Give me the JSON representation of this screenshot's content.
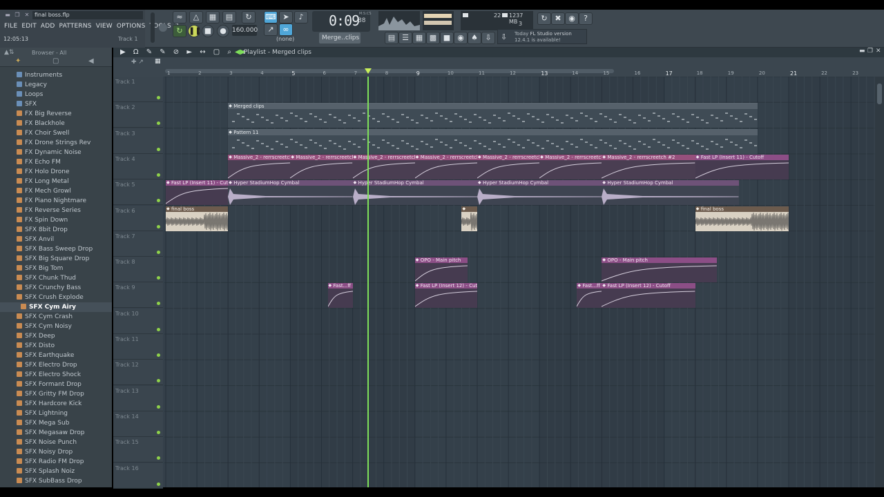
{
  "titlebar": {
    "filename": "final boss.flp"
  },
  "menu": [
    "FILE",
    "EDIT",
    "ADD",
    "PATTERNS",
    "VIEW",
    "OPTIONS",
    "TOOLS",
    "?"
  ],
  "status": {
    "time": "12:05:13",
    "hint": "Track 1"
  },
  "transport": {
    "tempo": "160.000",
    "time_main": "0:09",
    "time_sub": "88",
    "time_unit": "M:S:CS",
    "pattern": "Merge..clips",
    "none": "(none)"
  },
  "monitor": {
    "cpu": "22",
    "mem": "1237 MB",
    "poly": "3"
  },
  "news": {
    "title": "Today",
    "line1": "FL Studio version",
    "line2": "12.4.1 is available!"
  },
  "browser": {
    "title": "Browser - All",
    "items": [
      {
        "label": "Instruments",
        "kind": "folder"
      },
      {
        "label": "Legacy",
        "kind": "folder"
      },
      {
        "label": "Loops",
        "kind": "folder"
      },
      {
        "label": "SFX",
        "kind": "folder"
      },
      {
        "label": "FX Big Reverse",
        "kind": "file"
      },
      {
        "label": "FX Blackhole",
        "kind": "file"
      },
      {
        "label": "FX Choir Swell",
        "kind": "file"
      },
      {
        "label": "FX Drone Strings Rev",
        "kind": "file"
      },
      {
        "label": "FX Dynamic Noise",
        "kind": "file"
      },
      {
        "label": "FX Echo FM",
        "kind": "file"
      },
      {
        "label": "FX Holo Drone",
        "kind": "file"
      },
      {
        "label": "FX Long Metal",
        "kind": "file"
      },
      {
        "label": "FX Mech Growl",
        "kind": "file"
      },
      {
        "label": "FX Piano Nightmare",
        "kind": "file"
      },
      {
        "label": "FX Reverse Series",
        "kind": "file"
      },
      {
        "label": "FX Spin Down",
        "kind": "file"
      },
      {
        "label": "SFX 8bit Drop",
        "kind": "file"
      },
      {
        "label": "SFX Anvil",
        "kind": "file"
      },
      {
        "label": "SFX Bass Sweep Drop",
        "kind": "file"
      },
      {
        "label": "SFX Big Square Drop",
        "kind": "file"
      },
      {
        "label": "SFX Big Tom",
        "kind": "file"
      },
      {
        "label": "SFX Chunk Thud",
        "kind": "file"
      },
      {
        "label": "SFX Crunchy Bass",
        "kind": "file"
      },
      {
        "label": "SFX Crush Explode",
        "kind": "file"
      },
      {
        "label": "SFX Cym Airy",
        "kind": "file",
        "selected": true
      },
      {
        "label": "SFX Cym Crash",
        "kind": "file"
      },
      {
        "label": "SFX Cym Noisy",
        "kind": "file"
      },
      {
        "label": "SFX Deep",
        "kind": "file"
      },
      {
        "label": "SFX Disto",
        "kind": "file"
      },
      {
        "label": "SFX Earthquake",
        "kind": "file"
      },
      {
        "label": "SFX Electro Drop",
        "kind": "file"
      },
      {
        "label": "SFX Electro Shock",
        "kind": "file"
      },
      {
        "label": "SFX Formant Drop",
        "kind": "file"
      },
      {
        "label": "SFX Gritty FM Drop",
        "kind": "file"
      },
      {
        "label": "SFX Hardcore Kick",
        "kind": "file"
      },
      {
        "label": "SFX Lightning",
        "kind": "file"
      },
      {
        "label": "SFX Mega Sub",
        "kind": "file"
      },
      {
        "label": "SFX Megasaw Drop",
        "kind": "file"
      },
      {
        "label": "SFX Noise Punch",
        "kind": "file"
      },
      {
        "label": "SFX Noisy Drop",
        "kind": "file"
      },
      {
        "label": "SFX Radio FM Drop",
        "kind": "file"
      },
      {
        "label": "SFX Splash Noiz",
        "kind": "file"
      },
      {
        "label": "SFX SubBass Drop",
        "kind": "file"
      }
    ]
  },
  "playlist": {
    "title": "Playlist - Merged clips",
    "bars": [
      "1",
      "2",
      "3",
      "4",
      "5",
      "6",
      "7",
      "8",
      "9",
      "10",
      "11",
      "12",
      "13",
      "14",
      "15",
      "16",
      "17",
      "18",
      "19",
      "20",
      "21",
      "22",
      "23"
    ],
    "tracks": [
      "Track 1",
      "Track 2",
      "Track 3",
      "Track 4",
      "Track 5",
      "Track 6",
      "Track 7",
      "Track 8",
      "Track 9",
      "Track 10",
      "Track 11",
      "Track 12",
      "Track 13",
      "Track 14",
      "Track 15",
      "Track 16"
    ],
    "playhead_bar": 7.5,
    "clips": [
      {
        "track": 2,
        "start": 3,
        "end": 20,
        "label": "Merged clips",
        "type": "pattern"
      },
      {
        "track": 3,
        "start": 3,
        "end": 20,
        "label": "Pattern 11",
        "type": "pattern"
      },
      {
        "track": 4,
        "start": 3,
        "end": 5,
        "label": "Massive_2 - rerrscreetch",
        "type": "auto"
      },
      {
        "track": 4,
        "start": 5,
        "end": 7,
        "label": "Massive_2 - rerrscreetch",
        "type": "auto"
      },
      {
        "track": 4,
        "start": 7,
        "end": 9,
        "label": "Massive_2 - rerrscreetch",
        "type": "auto"
      },
      {
        "track": 4,
        "start": 9,
        "end": 11,
        "label": "Massive_2 - rerrscreetch",
        "type": "auto"
      },
      {
        "track": 4,
        "start": 11,
        "end": 13,
        "label": "Massive_2 - rerrscreetch",
        "type": "auto"
      },
      {
        "track": 4,
        "start": 13,
        "end": 15,
        "label": "Massive_2 - rerrscreetch",
        "type": "auto"
      },
      {
        "track": 4,
        "start": 15,
        "end": 18,
        "label": "Massive_2 - rerrscreetch #2",
        "type": "auto"
      },
      {
        "track": 4,
        "start": 18,
        "end": 21,
        "label": "Fast LP (Insert 11) - Cutoff",
        "type": "auto2"
      },
      {
        "track": 5,
        "start": 1,
        "end": 3,
        "label": "Fast LP (Insert 11) - Cutoff",
        "type": "auto2"
      },
      {
        "track": 5,
        "start": 3,
        "end": 7,
        "label": "Hyper StadiumHop Cymbal",
        "type": "cymbal"
      },
      {
        "track": 5,
        "start": 7,
        "end": 11,
        "label": "Hyper StadiumHop Cymbal",
        "type": "cymbal"
      },
      {
        "track": 5,
        "start": 11,
        "end": 15,
        "label": "Hyper StadiumHop Cymbal",
        "type": "cymbal"
      },
      {
        "track": 5,
        "start": 15,
        "end": 19.4,
        "label": "Hyper StadiumHop Cymbal",
        "type": "cymbal"
      },
      {
        "track": 6,
        "start": 1,
        "end": 3,
        "label": "final boss",
        "type": "audio"
      },
      {
        "track": 6,
        "start": 10.5,
        "end": 11,
        "label": "",
        "type": "audio"
      },
      {
        "track": 6,
        "start": 18,
        "end": 21,
        "label": "final boss",
        "type": "audio"
      },
      {
        "track": 8,
        "start": 9,
        "end": 10.7,
        "label": "OPO - Main pitch",
        "type": "auto2"
      },
      {
        "track": 8,
        "start": 15,
        "end": 18.7,
        "label": "OPO - Main pitch",
        "type": "auto2"
      },
      {
        "track": 9,
        "start": 6.2,
        "end": 7,
        "label": "Fast...ff",
        "type": "auto2"
      },
      {
        "track": 9,
        "start": 9,
        "end": 11,
        "label": "Fast LP (Insert 12) - Cutoff",
        "type": "auto2"
      },
      {
        "track": 9,
        "start": 14.2,
        "end": 15,
        "label": "Fast...ff",
        "type": "auto2"
      },
      {
        "track": 9,
        "start": 15,
        "end": 18,
        "label": "Fast LP (Insert 12) - Cutoff",
        "type": "auto2"
      }
    ]
  }
}
